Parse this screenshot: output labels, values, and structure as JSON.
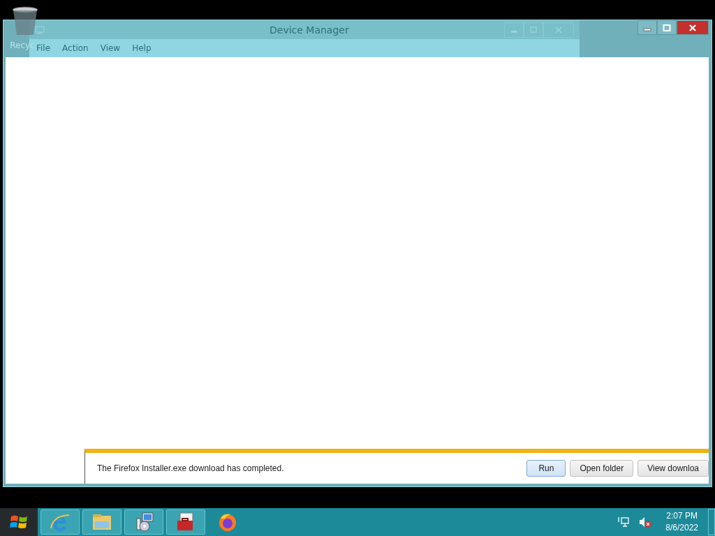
{
  "desktop": {
    "icons": [
      {
        "label": "Recyc"
      }
    ]
  },
  "ghost_window": {
    "title": "Device Manager",
    "menu": [
      "File",
      "Action",
      "View",
      "Help"
    ]
  },
  "notification": {
    "message": "The Firefox Installer.exe download has completed.",
    "buttons": [
      {
        "label": "Run",
        "selected": true
      },
      {
        "label": "Open folder",
        "selected": false
      },
      {
        "label": "View downloa",
        "selected": false
      }
    ]
  },
  "taskbar": {
    "apps": [
      {
        "kind": "browser",
        "running": true
      },
      {
        "kind": "folder",
        "running": true
      },
      {
        "kind": "installer",
        "running": true
      },
      {
        "kind": "toolbox",
        "running": true
      },
      {
        "kind": "firefox",
        "running": false
      }
    ],
    "time": "2:07 PM",
    "date": "8/6/2022"
  }
}
